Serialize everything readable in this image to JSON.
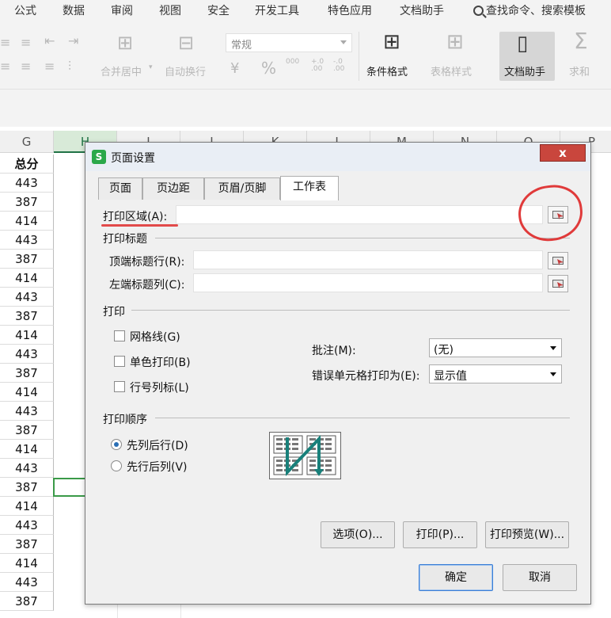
{
  "menubar": {
    "items": [
      "公式",
      "数据",
      "审阅",
      "视图",
      "安全",
      "开发工具",
      "特色应用",
      "文档助手"
    ],
    "search": "查找命令、搜索模板"
  },
  "ribbon": {
    "merge_center": "合并居中",
    "auto_wrap": "自动换行",
    "number_format": "常规",
    "percent": "%",
    "thousands": "000",
    "dec_inc": "+.0 .00",
    "dec_dec": "-.0 .00",
    "conditional_format": "条件格式",
    "table_style": "表格样式",
    "doc_assistant": "文档助手",
    "sum": "求和"
  },
  "sheet": {
    "columns": [
      "G",
      "H",
      "I",
      "J",
      "K",
      "L",
      "M",
      "N",
      "O",
      "P"
    ],
    "selected_column": "H",
    "header_cell": "总分",
    "values": [
      "443",
      "387",
      "414",
      "443",
      "387",
      "414",
      "443",
      "387",
      "414",
      "443",
      "387",
      "414",
      "443",
      "387",
      "414",
      "443",
      "387",
      "414",
      "443",
      "387",
      "414",
      "443",
      "387"
    ]
  },
  "dialog": {
    "title": "页面设置",
    "close_label": "x",
    "tabs": [
      "页面",
      "页边距",
      "页眉/页脚",
      "工作表"
    ],
    "active_tab": "工作表",
    "print_area_label": "打印区域(A):",
    "print_titles_group": "打印标题",
    "top_rows_label": "顶端标题行(R):",
    "left_cols_label": "左端标题列(C):",
    "print_group": "打印",
    "gridlines_label": "网格线(G)",
    "mono_label": "单色打印(B)",
    "rowcol_label": "行号列标(L)",
    "comments_label": "批注(M):",
    "comments_value": "(无)",
    "errors_label": "错误单元格打印为(E):",
    "errors_value": "显示值",
    "order_group": "打印顺序",
    "down_then_over": "先列后行(D)",
    "over_then_down": "先行后列(V)",
    "options_button": "选项(O)...",
    "print_button": "打印(P)...",
    "preview_button": "打印预览(W)...",
    "ok_button": "确定",
    "cancel_button": "取消"
  },
  "colors": {
    "annotation": "#e03a3a",
    "accent": "#217346",
    "close": "#c9463d"
  }
}
